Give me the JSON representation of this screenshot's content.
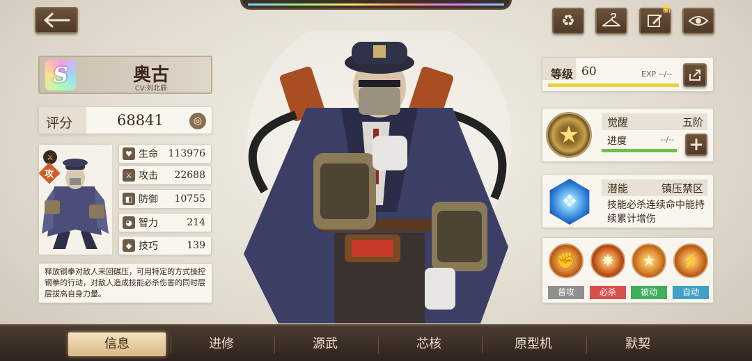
{
  "header": {
    "back_icon": "arrow-left-icon",
    "actions": [
      {
        "name": "recycle",
        "icon": "recycle-icon",
        "glyph": "♻"
      },
      {
        "name": "wardrobe",
        "icon": "hanger-icon",
        "glyph": "⌂"
      },
      {
        "name": "edit",
        "icon": "edit-icon",
        "glyph": "✎",
        "badge": "新"
      },
      {
        "name": "view",
        "icon": "eye-icon",
        "glyph": "◉"
      }
    ]
  },
  "character": {
    "rank": "S",
    "name": "奥古",
    "cv": "CV:刘北辰",
    "score_label": "评分",
    "score": "68841",
    "class_tag": "攻",
    "description": "释放钢拳对敌人来回碾压，可用特定的方式操控钢拳的行动，对敌人造成技能必杀伤害的同时层层拔高自身力量。"
  },
  "stats": [
    {
      "key": "hp",
      "label": "生命",
      "value": "113976",
      "icon": "heart-icon",
      "glyph": "♥"
    },
    {
      "key": "atk",
      "label": "攻击",
      "value": "22688",
      "icon": "sword-icon",
      "glyph": "⚔"
    },
    {
      "key": "def",
      "label": "防御",
      "value": "10755",
      "icon": "shield-icon",
      "glyph": "◧"
    },
    {
      "key": "int",
      "label": "智力",
      "value": "214",
      "icon": "brain-icon",
      "glyph": "◕"
    },
    {
      "key": "skill",
      "label": "技巧",
      "value": "139",
      "icon": "cube-icon",
      "glyph": "◆"
    }
  ],
  "level": {
    "label": "等级",
    "value": "60",
    "exp_text": "EXP --/--",
    "exp_fraction": 1.0
  },
  "awaken": {
    "label": "觉醒",
    "value": "五阶",
    "progress_label": "进度",
    "progress_value": "--/--"
  },
  "potential": {
    "label": "潜能",
    "name": "镇压禁区",
    "description": "技能必杀连续命中能持续累计增伤"
  },
  "skills": [
    {
      "tag": "普攻",
      "tag_color": "#8f8f8f",
      "icon": "fist-skill-icon",
      "glyph": "✊",
      "bg": "#c9671c"
    },
    {
      "tag": "必杀",
      "tag_color": "#d8504a",
      "icon": "burst-skill-icon",
      "glyph": "✸",
      "bg": "#c3501c"
    },
    {
      "tag": "被动",
      "tag_color": "#3fae5a",
      "icon": "star-skill-icon",
      "glyph": "★",
      "bg": "#d0761c"
    },
    {
      "tag": "自动",
      "tag_color": "#3fa0c8",
      "icon": "claw-skill-icon",
      "glyph": "⚡",
      "bg": "#c8661a"
    }
  ],
  "nav": {
    "tabs": [
      "信息",
      "进修",
      "源武",
      "芯核",
      "原型机",
      "默契"
    ],
    "active": 0
  }
}
